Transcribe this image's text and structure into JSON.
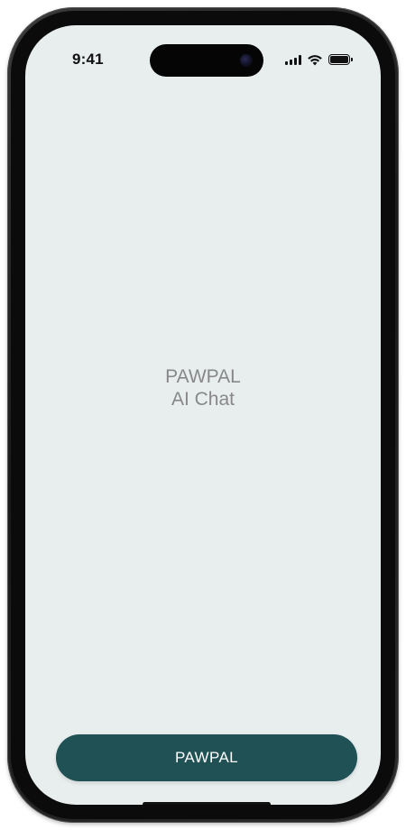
{
  "status_bar": {
    "time": "9:41",
    "icons": [
      "signal-icon",
      "wifi-icon",
      "battery-icon"
    ]
  },
  "main": {
    "title_line1": "PAWPAL",
    "title_line2": "AI Chat"
  },
  "bottom_button": {
    "label": "PAWPAL"
  },
  "colors": {
    "screen_background": "#e8eeee",
    "button_background": "#1f5155",
    "title_text": "#888888"
  }
}
